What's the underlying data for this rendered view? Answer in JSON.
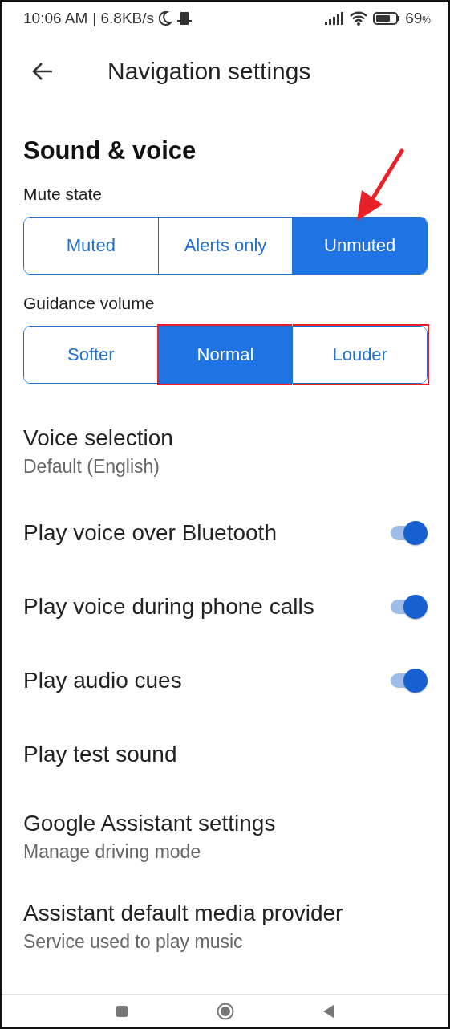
{
  "status_bar": {
    "time": "10:06 AM",
    "speed": "| 6.8KB/s",
    "battery": "69",
    "battery_unit": "%"
  },
  "header": {
    "title": "Navigation settings"
  },
  "section": {
    "title": "Sound & voice"
  },
  "segments": [
    {
      "label": "Mute state",
      "options": [
        {
          "label": "Muted",
          "selected": false,
          "highlighted": false,
          "pointed": false
        },
        {
          "label": "Alerts only",
          "selected": false,
          "highlighted": false,
          "pointed": false
        },
        {
          "label": "Unmuted",
          "selected": true,
          "highlighted": false,
          "pointed": true
        }
      ]
    },
    {
      "label": "Guidance volume",
      "options": [
        {
          "label": "Softer",
          "selected": false,
          "highlighted": false,
          "pointed": false
        },
        {
          "label": "Normal",
          "selected": true,
          "highlighted": true,
          "pointed": false
        },
        {
          "label": "Louder",
          "selected": false,
          "highlighted": true,
          "pointed": false
        }
      ]
    }
  ],
  "settings": [
    {
      "kind": "text",
      "title": "Voice selection",
      "subtitle": "Default (English)"
    },
    {
      "kind": "toggle",
      "title": "Play voice over Bluetooth",
      "on": true
    },
    {
      "kind": "toggle",
      "title": "Play voice during phone calls",
      "on": true
    },
    {
      "kind": "toggle",
      "title": "Play audio cues",
      "on": true
    },
    {
      "kind": "text",
      "title": "Play test sound"
    },
    {
      "kind": "text",
      "title": "Google Assistant settings",
      "subtitle": "Manage driving mode"
    },
    {
      "kind": "text",
      "title": "Assistant default media provider",
      "subtitle": "Service used to play music"
    }
  ]
}
